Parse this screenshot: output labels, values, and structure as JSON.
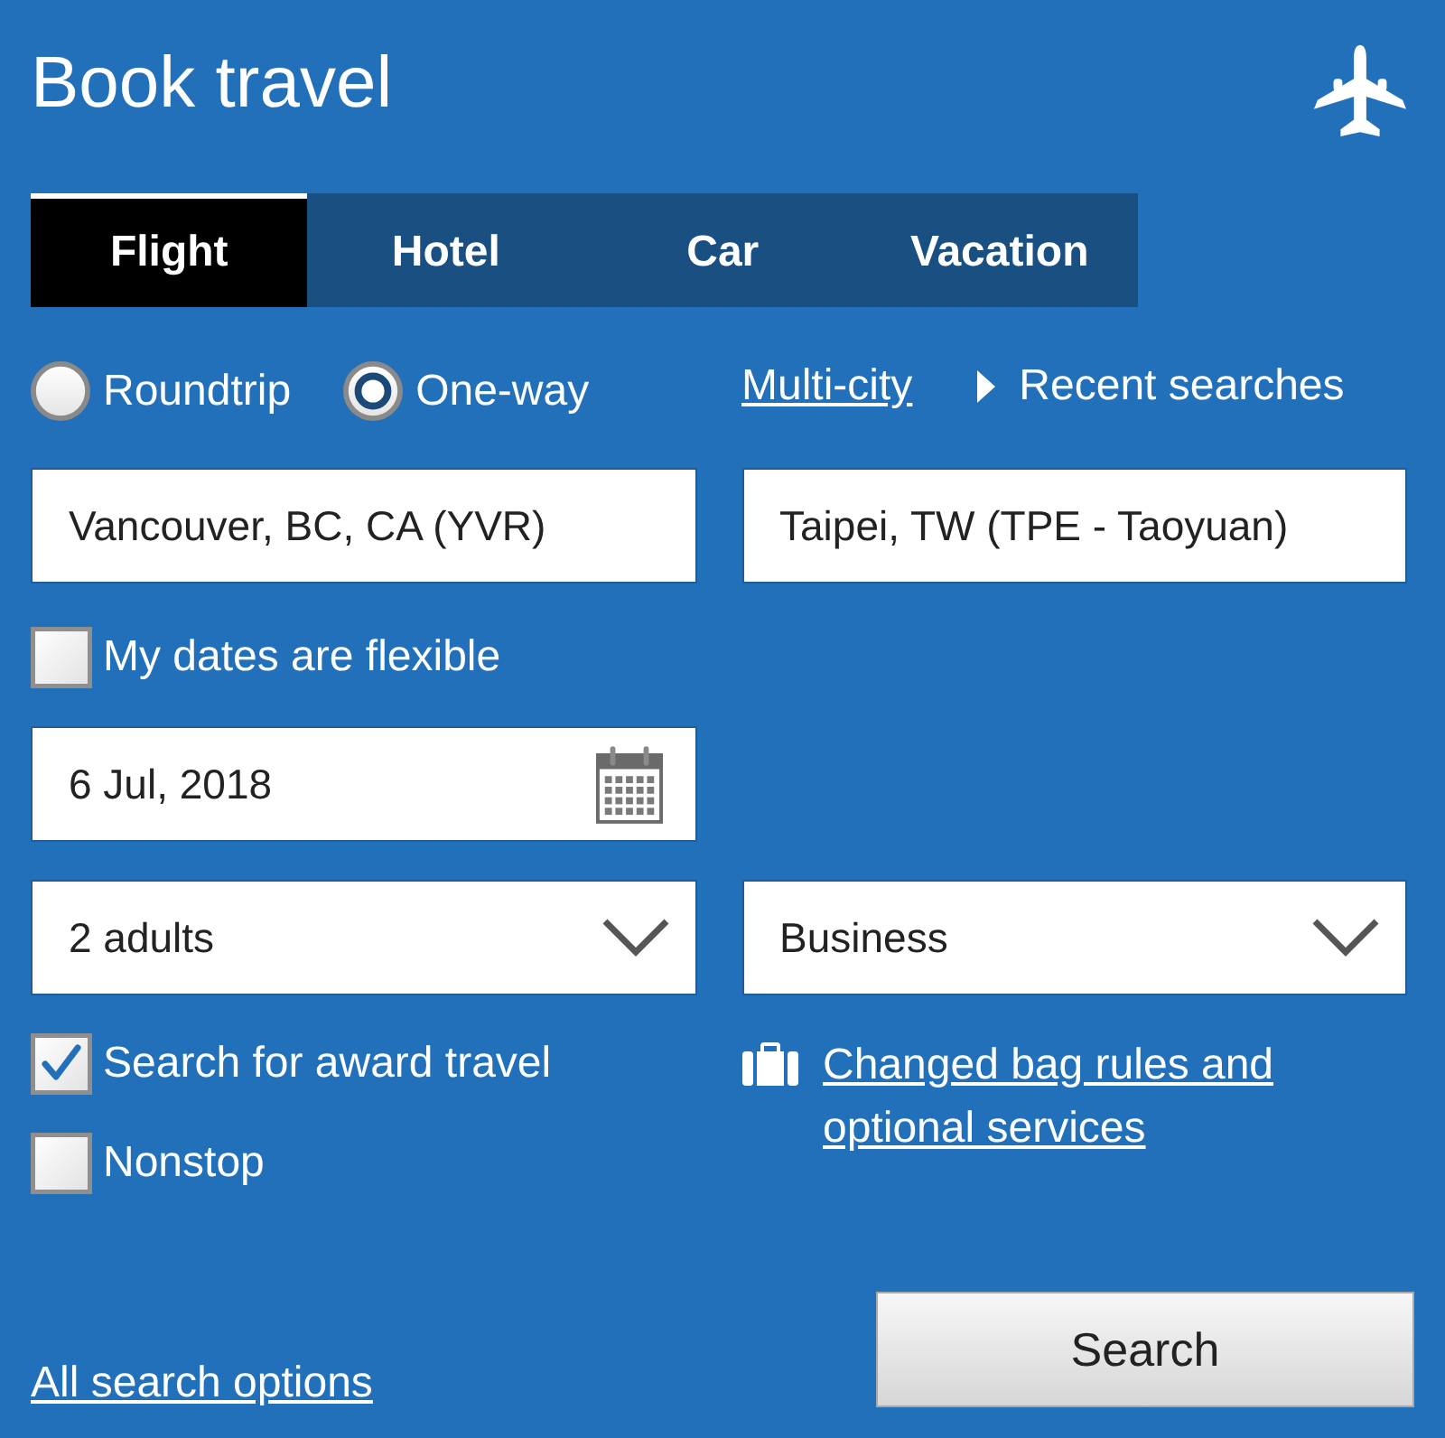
{
  "header": {
    "title": "Book travel"
  },
  "tabs": [
    {
      "label": "Flight",
      "selected": true
    },
    {
      "label": "Hotel",
      "selected": false
    },
    {
      "label": "Car",
      "selected": false
    },
    {
      "label": "Vacation",
      "selected": false
    }
  ],
  "trip_types": [
    {
      "label": "Roundtrip",
      "selected": false
    },
    {
      "label": "One-way",
      "selected": true
    }
  ],
  "multi_city_link": "Multi-city",
  "recent_searches": "Recent searches",
  "origin": {
    "value": "Vancouver, BC, CA (YVR)"
  },
  "destination": {
    "value": "Taipei, TW (TPE - Taoyuan)"
  },
  "flexible_dates": {
    "label": "My dates are flexible",
    "checked": false
  },
  "departure_date": {
    "value": "6 Jul, 2018"
  },
  "passengers": {
    "value": "2 adults"
  },
  "cabin": {
    "value": "Business"
  },
  "options": [
    {
      "label": "Search for award travel",
      "checked": true
    },
    {
      "label": "Nonstop",
      "checked": false
    }
  ],
  "bag_link": "Changed bag rules and optional services",
  "all_options_link": "All search options",
  "search_button": "Search"
}
